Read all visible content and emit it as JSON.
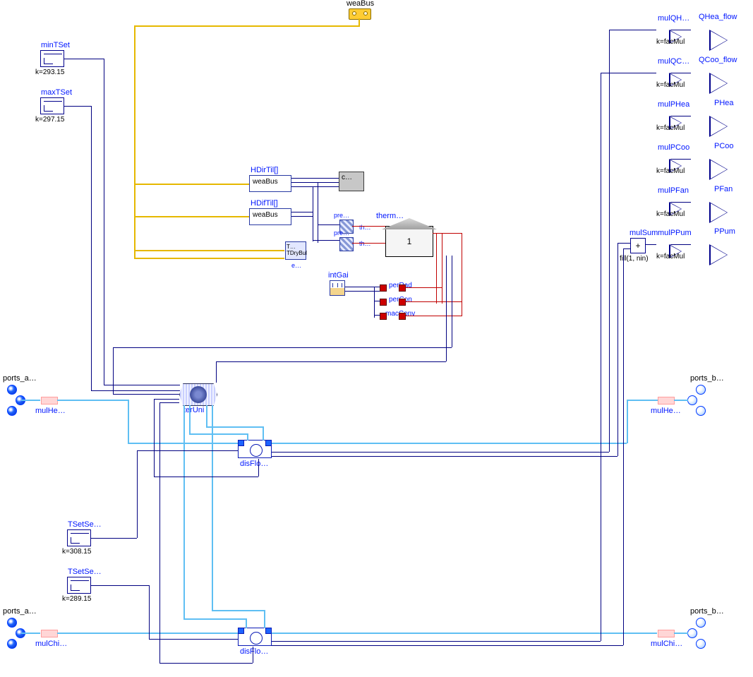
{
  "weaBus": {
    "label": "weaBus"
  },
  "minTSet": {
    "label": "minTSet",
    "k": "k=293.15"
  },
  "maxTSet": {
    "label": "maxTSet",
    "k": "k=297.15"
  },
  "TSetSeHea": {
    "label": "TSetSe…",
    "k": "k=308.15"
  },
  "TSetSeCoo": {
    "label": "TSetSe…",
    "k": "k=289.15"
  },
  "HDirTil": {
    "label": "HDirTil[]"
  },
  "HDifTil": {
    "label": "HDifTil[]"
  },
  "weaBox1": {
    "text": "weaBus"
  },
  "weaBox2": {
    "text": "weaBus"
  },
  "cBlock": {
    "text": "c…"
  },
  "eLabel": {
    "text": "e…"
  },
  "tdrybul": {
    "text": "TDryBul",
    "text2": "T…"
  },
  "intGai": {
    "label": "intGai"
  },
  "pre1": {
    "label": "pre…"
  },
  "pre2": {
    "label": "pre…"
  },
  "th1": {
    "label": "th…"
  },
  "th2": {
    "label": "th…"
  },
  "therm": {
    "label": "therm…"
  },
  "zone": {
    "num": "1"
  },
  "perRad": {
    "label": "perRad"
  },
  "perCon": {
    "label": "perCon"
  },
  "macConv": {
    "label": "macConv"
  },
  "terUni": {
    "label": "terUni"
  },
  "disFloHea": {
    "label": "disFlo…"
  },
  "disFloCoo": {
    "label": "disFlo…"
  },
  "ports_a_top": {
    "label": "ports_a…"
  },
  "ports_b_top": {
    "label": "ports_b…"
  },
  "ports_a_bot": {
    "label": "ports_a…"
  },
  "ports_b_bot": {
    "label": "ports_b…"
  },
  "mulHeaIn": {
    "label": "mulHe…"
  },
  "mulHeaOut": {
    "label": "mulHe…"
  },
  "mulChiIn": {
    "label": "mulChi…"
  },
  "mulChiOut": {
    "label": "mulChi…"
  },
  "mulQH": {
    "label": "mulQH…",
    "k": "k=facMul"
  },
  "mulQC": {
    "label": "mulQC…",
    "k": "k=facMul"
  },
  "mulPHea": {
    "label": "mulPHea",
    "k": "k=facMul"
  },
  "mulPCoo": {
    "label": "mulPCoo",
    "k": "k=facMul"
  },
  "mulPFan": {
    "label": "mulPFan",
    "k": "k=facMul"
  },
  "mulSum": {
    "label": "mulSum",
    "fill": "fill(1, nin)"
  },
  "mulPPum": {
    "label": "mulPPum",
    "k": "k=facMul"
  },
  "QHea_flow": {
    "label": "QHea_flow"
  },
  "QCoo_flow": {
    "label": "QCoo_flow"
  },
  "PHea": {
    "label": "PHea"
  },
  "PCoo": {
    "label": "PCoo"
  },
  "PFan": {
    "label": "PFan"
  },
  "PPum": {
    "label": "PPum"
  }
}
